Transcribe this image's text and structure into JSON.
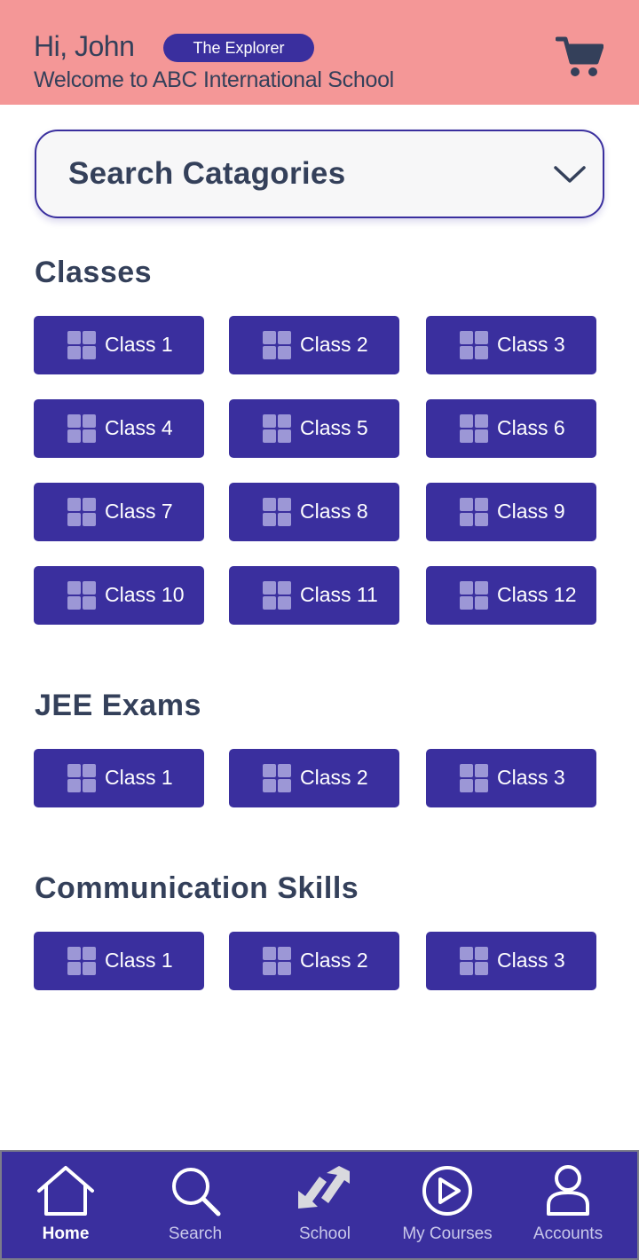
{
  "header": {
    "greeting": "Hi, John",
    "badge": "The Explorer",
    "welcome": "Welcome to ABC International School",
    "cart_icon": "cart-icon"
  },
  "search": {
    "label": "Search Catagories",
    "icon": "chevron-down-icon"
  },
  "sections": [
    {
      "title": "Classes",
      "items": [
        "Class 1",
        "Class 2",
        "Class 3",
        "Class 4",
        "Class 5",
        "Class 6",
        "Class 7",
        "Class 8",
        "Class 9",
        "Class 10",
        "Class 11",
        "Class 12"
      ]
    },
    {
      "title": "JEE Exams",
      "items": [
        "Class 1",
        "Class 2",
        "Class 3"
      ]
    },
    {
      "title": "Communication Skills",
      "items": [
        "Class 1",
        "Class 2",
        "Class 3"
      ]
    }
  ],
  "nav": [
    {
      "label": "Home",
      "icon": "home-icon",
      "active": true
    },
    {
      "label": "Search",
      "icon": "search-icon",
      "active": false
    },
    {
      "label": "School",
      "icon": "school-icon",
      "active": false
    },
    {
      "label": "My Courses",
      "icon": "play-icon",
      "active": false
    },
    {
      "label": "Accounts",
      "icon": "user-icon",
      "active": false
    }
  ],
  "colors": {
    "header_bg": "#f49797",
    "primary": "#3a2f9e",
    "text": "#34405a",
    "icon_tile": "#9c97d6"
  }
}
